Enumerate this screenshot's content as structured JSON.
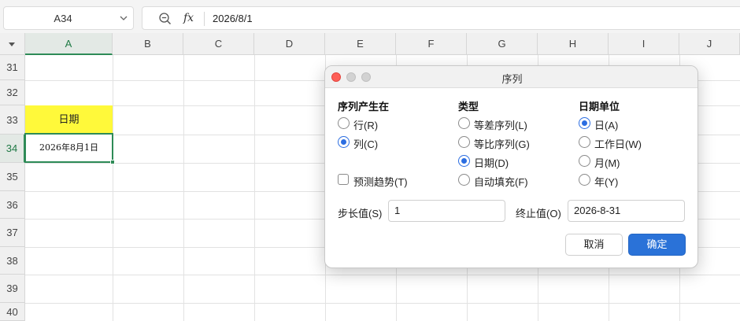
{
  "formula_bar": {
    "name_box": "A34",
    "fx_label": "fx",
    "formula_value": "2026/8/1"
  },
  "grid": {
    "columns": [
      "A",
      "B",
      "C",
      "D",
      "E",
      "F",
      "G",
      "H",
      "I",
      "J"
    ],
    "rows": [
      "31",
      "32",
      "33",
      "34",
      "35",
      "36",
      "37",
      "38",
      "39",
      "40"
    ],
    "active_column": "A",
    "active_row": "34",
    "cells": {
      "A33": "日期",
      "A34": "2026年8月1日"
    },
    "highlight_color": "#fff93a",
    "selection_color": "#2e8b57"
  },
  "dialog": {
    "title": "序列",
    "series_in": {
      "heading": "序列产生在",
      "options": [
        {
          "label": "行(R)",
          "checked": false
        },
        {
          "label": "列(C)",
          "checked": true
        }
      ]
    },
    "type": {
      "heading": "类型",
      "options": [
        {
          "label": "等差序列(L)",
          "checked": false
        },
        {
          "label": "等比序列(G)",
          "checked": false
        },
        {
          "label": "日期(D)",
          "checked": true
        },
        {
          "label": "自动填充(F)",
          "checked": false
        }
      ]
    },
    "date_unit": {
      "heading": "日期单位",
      "options": [
        {
          "label": "日(A)",
          "checked": true
        },
        {
          "label": "工作日(W)",
          "checked": false
        },
        {
          "label": "月(M)",
          "checked": false
        },
        {
          "label": "年(Y)",
          "checked": false
        }
      ]
    },
    "trend": {
      "label": "预测趋势(T)",
      "checked": false
    },
    "step": {
      "label": "步长值(S)",
      "value": "1"
    },
    "stop": {
      "label": "终止值(O)",
      "value": "2026-8-31"
    },
    "cancel_label": "取消",
    "ok_label": "确定",
    "accent_color": "#2a72d8"
  }
}
